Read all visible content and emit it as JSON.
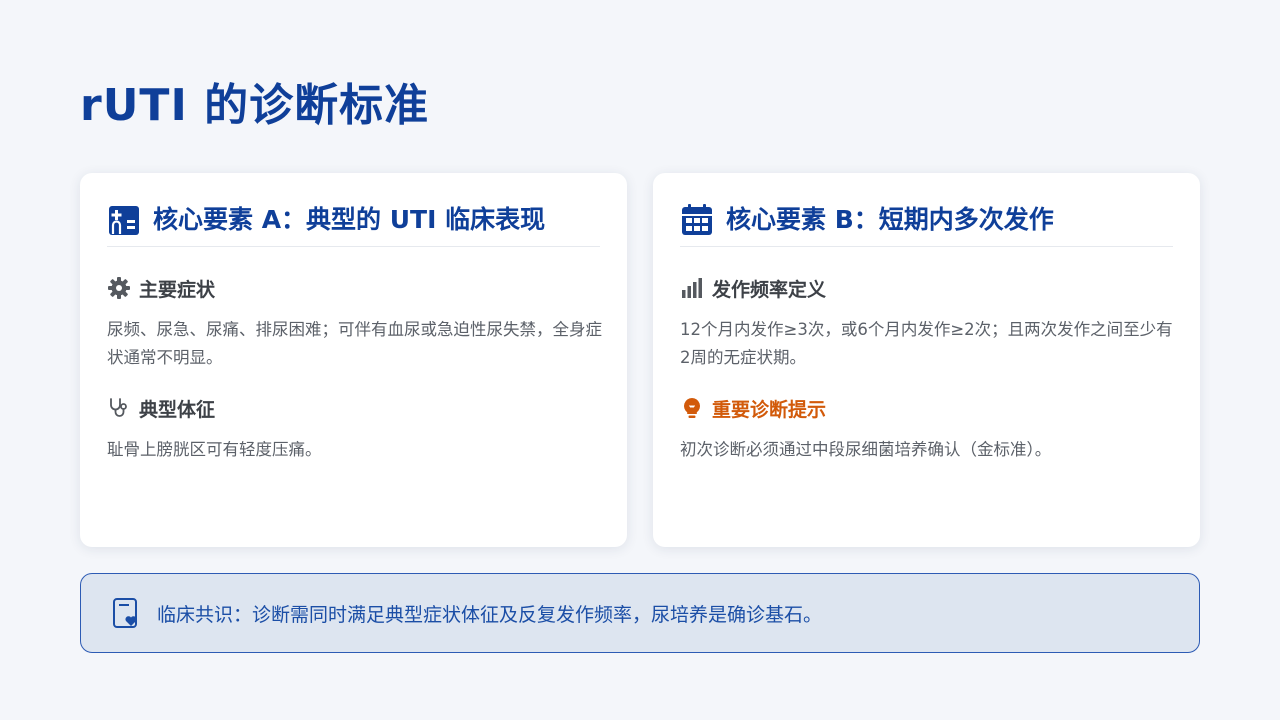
{
  "page": {
    "title": "rUTI 的诊断标准"
  },
  "cards": [
    {
      "icon": "hospital-icon",
      "title": "核心要素 A：典型的 UTI 临床表现",
      "sections": [
        {
          "icon": "gear-icon",
          "title": "主要症状",
          "text": "尿频、尿急、尿痛、排尿困难；可伴有血尿或急迫性尿失禁，全身症状通常不明显。"
        },
        {
          "icon": "stethoscope-icon",
          "title": "典型体征",
          "text": "耻骨上膀胱区可有轻度压痛。"
        }
      ]
    },
    {
      "icon": "calendar-icon",
      "title": "核心要素 B：短期内多次发作",
      "sections": [
        {
          "icon": "bar-chart-icon",
          "title": "发作频率定义",
          "text": "12个月内发作≥3次，或6个月内发作≥2次；且两次发作之间至少有2周的无症状期。"
        },
        {
          "icon": "lightbulb-icon",
          "title": "重要诊断提示",
          "text": "初次诊断必须通过中段尿细菌培养确认（金标准）。"
        }
      ]
    }
  ],
  "banner": {
    "icon": "clipboard-heart-icon",
    "text": "临床共识：诊断需同时满足典型症状体征及反复发作频率，尿培养是确诊基石。"
  },
  "colors": {
    "primary": "#0f3f99",
    "warning": "#d25a0a",
    "background": "#f4f6fa",
    "banner_bg": "#dde5f0"
  }
}
